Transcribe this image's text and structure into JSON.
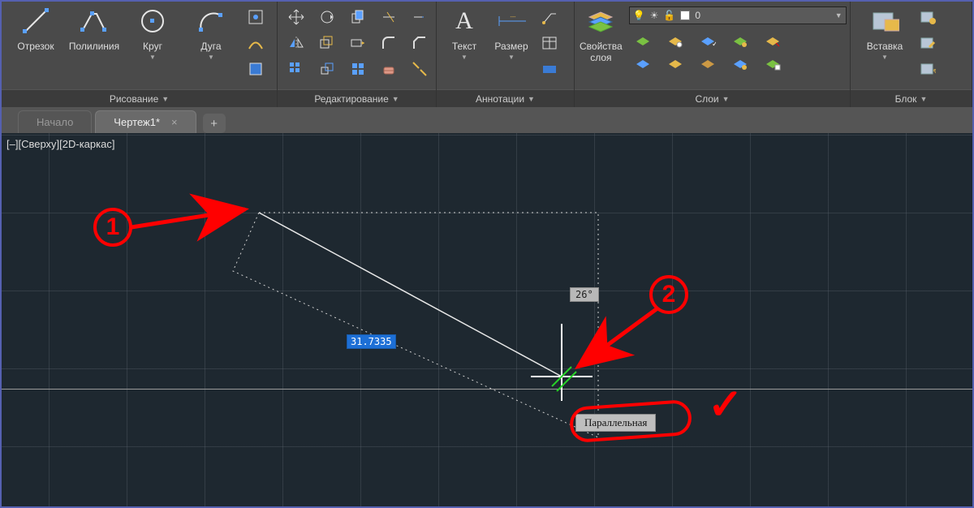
{
  "ribbon": {
    "draw": {
      "title": "Рисование",
      "line": "Отрезок",
      "polyline": "Полилиния",
      "circle": "Круг",
      "arc": "Дуга"
    },
    "modify": {
      "title": "Редактирование"
    },
    "annot": {
      "title": "Аннотации",
      "text": "Текст",
      "dim": "Размер"
    },
    "layers": {
      "title": "Слои",
      "props": "Свойства\nслоя",
      "current": "0"
    },
    "block": {
      "title": "Блок",
      "insert": "Вставка"
    }
  },
  "tabs": {
    "home": "Начало",
    "draw1": "Чертеж1*"
  },
  "viewport": {
    "label": "[–][Сверху][2D-каркас]",
    "distance": "31.7335",
    "angle": "26°",
    "snap_hint": "Параллельная"
  },
  "callouts": {
    "one": "1",
    "two": "2",
    "check": "✓"
  }
}
